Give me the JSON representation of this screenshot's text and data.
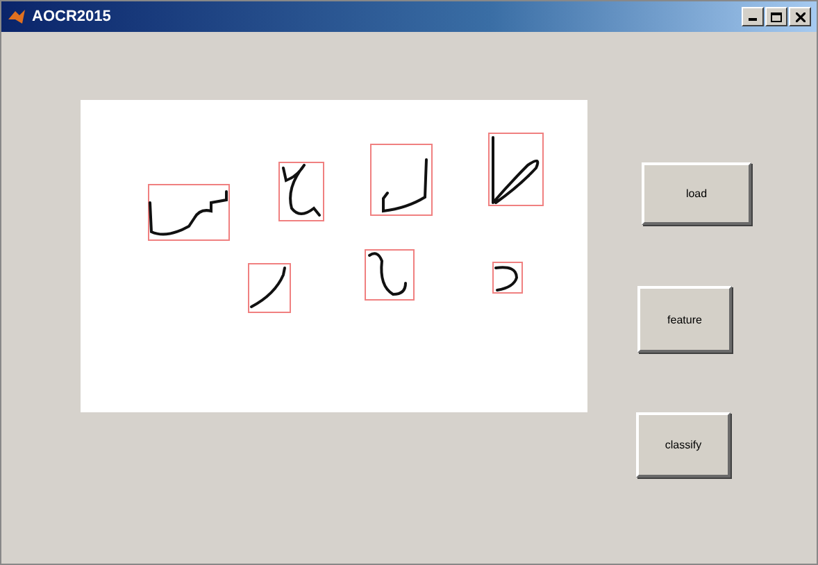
{
  "window": {
    "title": "AOCR2015"
  },
  "buttons": [
    {
      "label": "load"
    },
    {
      "label": "feature"
    },
    {
      "label": "classify"
    }
  ]
}
